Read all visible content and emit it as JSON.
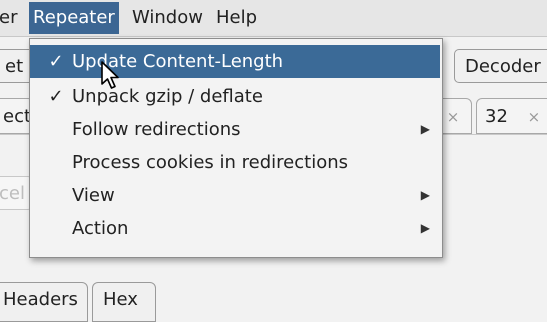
{
  "menubar": {
    "partial_left": "ler",
    "items": [
      {
        "label": "Repeater"
      },
      {
        "label": "Window"
      },
      {
        "label": "Help"
      }
    ]
  },
  "background": {
    "tab_partial_left": "et",
    "tab_decoder": "Decoder",
    "subtab_partial_left": "ecti",
    "subtab_32": "32",
    "close_glyph": "×",
    "ghost_button": "cel",
    "bottom_tab_headers": "Headers",
    "bottom_tab_hex": "Hex"
  },
  "dropdown": {
    "items": [
      {
        "check": "✓",
        "label": "Update Content-Length",
        "submenu": ""
      },
      {
        "check": "✓",
        "label": "Unpack gzip / deflate",
        "submenu": ""
      },
      {
        "check": "",
        "label": "Follow redirections",
        "submenu": "▶"
      },
      {
        "check": "",
        "label": "Process cookies in redirections",
        "submenu": ""
      },
      {
        "check": "",
        "label": "View",
        "submenu": "▶"
      },
      {
        "check": "",
        "label": "Action",
        "submenu": "▶"
      }
    ]
  },
  "colors": {
    "selection": "#3b6a97",
    "menubar_active": "#3c6693"
  }
}
